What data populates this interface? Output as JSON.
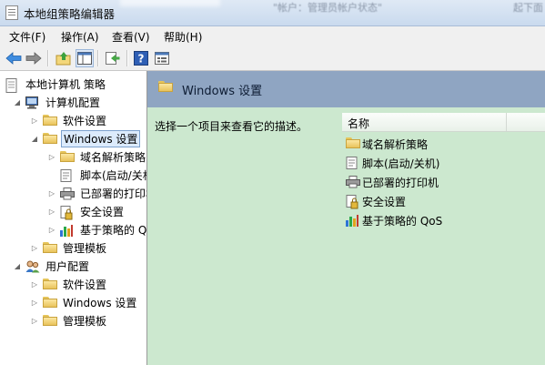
{
  "window": {
    "title": "本地组策略编辑器",
    "ghost_text_1": "\"帐户：管理员帐户状态\"",
    "ghost_text_2": "起下面"
  },
  "menu": [
    "文件(F)",
    "操作(A)",
    "查看(V)",
    "帮助(H)"
  ],
  "toolbar": {
    "buttons": [
      "back-icon",
      "forward-icon",
      "up-folder-icon",
      "show-hide-tree-icon",
      "export-list-icon",
      "help-icon",
      "properties-icon"
    ]
  },
  "tree": {
    "root": "本地计算机 策略",
    "computer_config": "计算机配置",
    "cc_software": "软件设置",
    "cc_windows": "Windows 设置",
    "cc_children": [
      "域名解析策略",
      "脚本(启动/关机)",
      "已部署的打印机",
      "安全设置",
      "基于策略的 QoS"
    ],
    "cc_admin": "管理模板",
    "user_config": "用户配置",
    "uc_software": "软件设置",
    "uc_windows": "Windows 设置",
    "uc_admin": "管理模板"
  },
  "detail": {
    "header_title": "Windows 设置",
    "description": "选择一个项目来查看它的描述。",
    "column_name": "名称",
    "items": [
      "域名解析策略",
      "脚本(启动/关机)",
      "已部署的打印机",
      "安全设置",
      "基于策略的 QoS"
    ]
  },
  "colors": {
    "detail_background": "#cce8cf",
    "detail_header": "#8fa5c2",
    "selection": "#dcebfc"
  }
}
